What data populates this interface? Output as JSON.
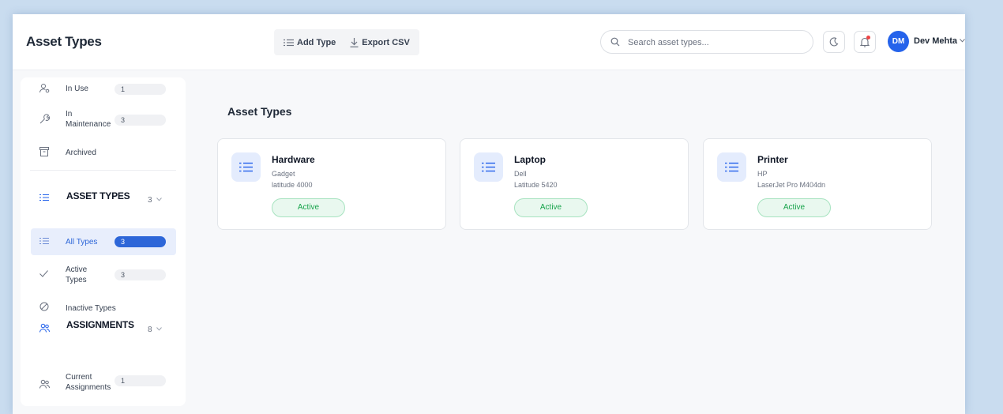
{
  "header": {
    "title": "Asset Types",
    "toolbar": {
      "add_label": "Add Type",
      "export_label": "Export CSV"
    },
    "search": {
      "placeholder": "Search asset types...",
      "value": ""
    },
    "user": {
      "initials": "DM",
      "name": "Dev Mehta"
    }
  },
  "sidebar": {
    "items_top": [
      {
        "label": "In Use",
        "count": "1",
        "icon": "users-cog-icon"
      },
      {
        "label": "In Maintenance",
        "count": "3",
        "icon": "wrench-icon"
      },
      {
        "label": "Archived",
        "icon": "archive-icon"
      }
    ],
    "asset_types_section": {
      "label": "ASSET TYPES",
      "count": "3",
      "icon": "list-icon",
      "items": [
        {
          "label": "All Types",
          "count": "3",
          "active": true,
          "icon": "list-icon"
        },
        {
          "label": "Active Types",
          "count": "3",
          "icon": "check-icon"
        },
        {
          "label": "Inactive Types",
          "icon": "ban-icon"
        }
      ]
    },
    "assignments_section": {
      "label": "ASSIGNMENTS",
      "count": "8",
      "icon": "users-icon",
      "items": [
        {
          "label": "Current Assignments",
          "count": "1",
          "icon": "users-icon"
        }
      ]
    }
  },
  "main": {
    "title": "Asset Types",
    "cards": [
      {
        "name": "Hardware",
        "brand": "Gadget",
        "model": "latitude 4000",
        "status": "Active"
      },
      {
        "name": "Laptop",
        "brand": "Dell",
        "model": "Latitude 5420",
        "status": "Active"
      },
      {
        "name": "Printer",
        "brand": "HP",
        "model": "LaserJet Pro M404dn",
        "status": "Active"
      }
    ]
  },
  "colors": {
    "accent": "#2563eb",
    "active_badge": "#2d66d8",
    "status_active_text": "#16a34a",
    "status_active_bg": "#e9f8ef",
    "notification_dot": "#ef4444"
  }
}
